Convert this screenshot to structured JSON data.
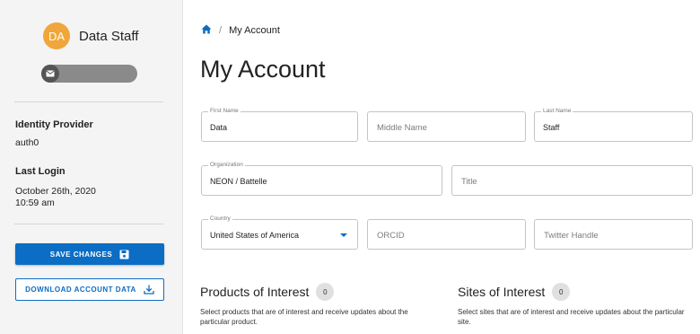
{
  "sidebar": {
    "avatar_initials": "DA",
    "user_name": "Data Staff",
    "identity_provider_label": "Identity Provider",
    "identity_provider_value": "auth0",
    "last_login_label": "Last Login",
    "last_login_date": "October 26th, 2020",
    "last_login_time": "10:59 am",
    "save_button_label": "SAVE CHANGES",
    "download_button_label": "DOWNLOAD ACCOUNT DATA"
  },
  "breadcrumb": {
    "current": "My Account"
  },
  "page_title": "My Account",
  "form": {
    "first_name": {
      "label": "First Name",
      "value": "Data"
    },
    "middle_name": {
      "placeholder": "Middle Name"
    },
    "last_name": {
      "label": "Last Name",
      "value": "Staff"
    },
    "organization": {
      "label": "Organization",
      "value": "NEON / Battelle"
    },
    "title": {
      "placeholder": "Title"
    },
    "country": {
      "label": "Country",
      "value": "United States of America"
    },
    "orcid": {
      "placeholder": "ORCID"
    },
    "twitter": {
      "placeholder": "Twitter Handle"
    }
  },
  "products": {
    "title": "Products of Interest",
    "count": "0",
    "description": "Select products that are of interest and receive updates about the particular product."
  },
  "sites": {
    "title": "Sites of Interest",
    "count": "0",
    "description": "Select sites that are of interest and receive updates about the particular site."
  },
  "colors": {
    "primary": "#0b6dc4",
    "avatar": "#f0a63a",
    "sidebar_bg": "#f4f4f4"
  }
}
